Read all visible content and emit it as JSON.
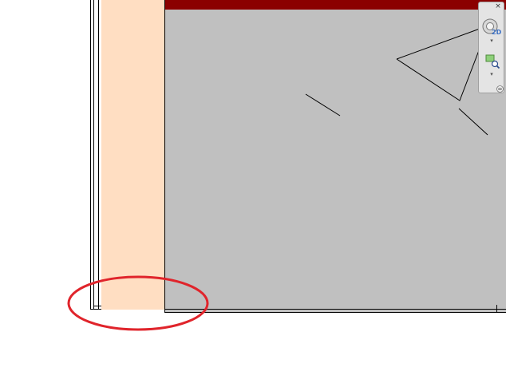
{
  "view": {
    "sheet_title_bar_color": "#8b0000",
    "viewport_color": "#c0c0c0",
    "wall_fill_color": "#ffdec2",
    "annotation_ellipse_color": "#e0242b"
  },
  "navigation_bar": {
    "close_label": "×",
    "wheel_mode_label": "2D",
    "wheel_dropdown_label": "▾",
    "zoom_dropdown_label": "▾",
    "icons": {
      "close": "close-icon",
      "wheel": "steering-wheel-icon",
      "zoom": "zoom-region-icon",
      "collapse": "collapse-icon"
    }
  }
}
